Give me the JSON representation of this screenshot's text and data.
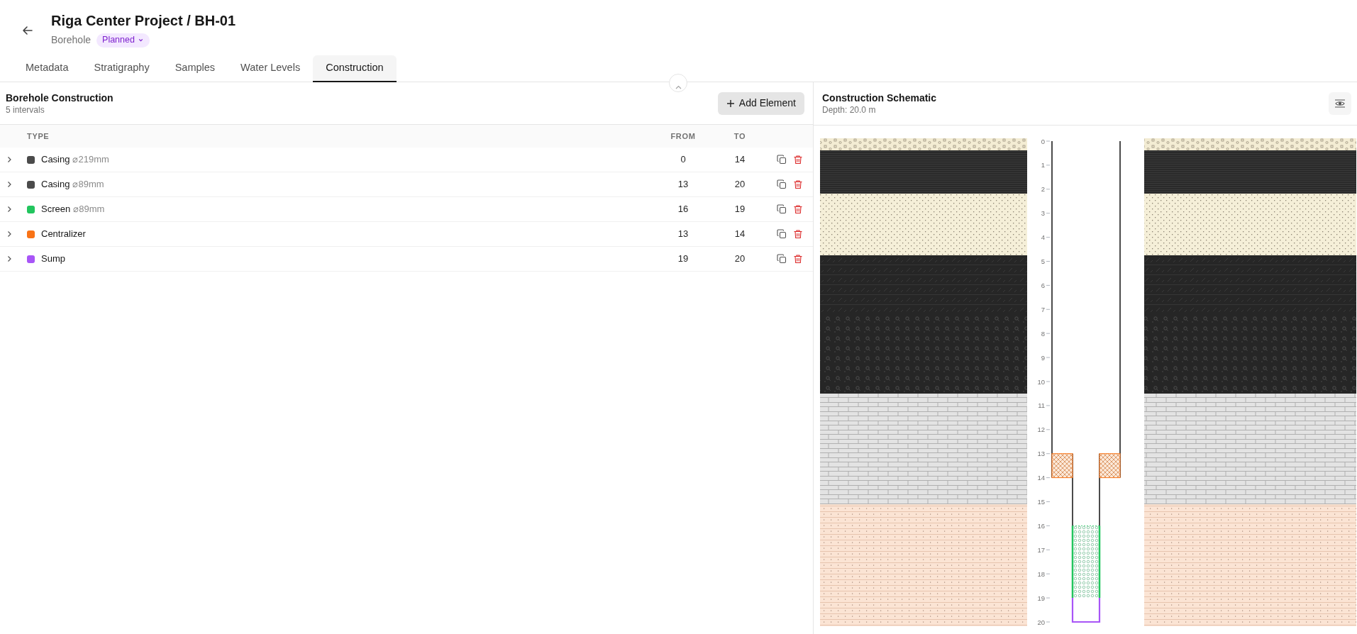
{
  "header": {
    "title": "Riga Center Project / BH-01",
    "subtitle": "Borehole",
    "status": "Planned"
  },
  "tabs": [
    {
      "label": "Metadata",
      "selected": false
    },
    {
      "label": "Stratigraphy",
      "selected": false
    },
    {
      "label": "Samples",
      "selected": false
    },
    {
      "label": "Water Levels",
      "selected": false
    },
    {
      "label": "Construction",
      "selected": true
    }
  ],
  "construction": {
    "title": "Borehole Construction",
    "subtitle": "5 intervals",
    "add_button": "Add Element",
    "columns": [
      "TYPE",
      "FROM",
      "TO"
    ],
    "rows": [
      {
        "kind": "casing",
        "type": "Casing",
        "diameter": "⌀219mm",
        "from": "0",
        "to": "14",
        "color": "#4b4b4b",
        "expanded": false
      },
      {
        "kind": "casing",
        "type": "Casing",
        "diameter": "⌀89mm",
        "from": "13",
        "to": "20",
        "color": "#4b4b4b",
        "expanded": false
      },
      {
        "kind": "screen",
        "type": "Screen",
        "diameter": "⌀89mm",
        "from": "16",
        "to": "19",
        "color": "#22c55e",
        "expanded": false
      },
      {
        "kind": "centralizer",
        "type": "Centralizer",
        "from": "13",
        "to": "14",
        "color": "#f97316",
        "expanded": false
      },
      {
        "kind": "sump",
        "type": "Sump",
        "from": "19",
        "to": "20",
        "color": "#a855f7",
        "expanded": false
      }
    ]
  },
  "schematic": {
    "title": "Construction Schematic",
    "subtitle": "Depth: 20.0 m",
    "depth_ticks": [
      "0",
      "1",
      "2",
      "3",
      "4",
      "5",
      "6",
      "7",
      "8",
      "9",
      "10",
      "11",
      "12",
      "13",
      "14",
      "15",
      "16",
      "17",
      "18",
      "19",
      "20"
    ]
  }
}
